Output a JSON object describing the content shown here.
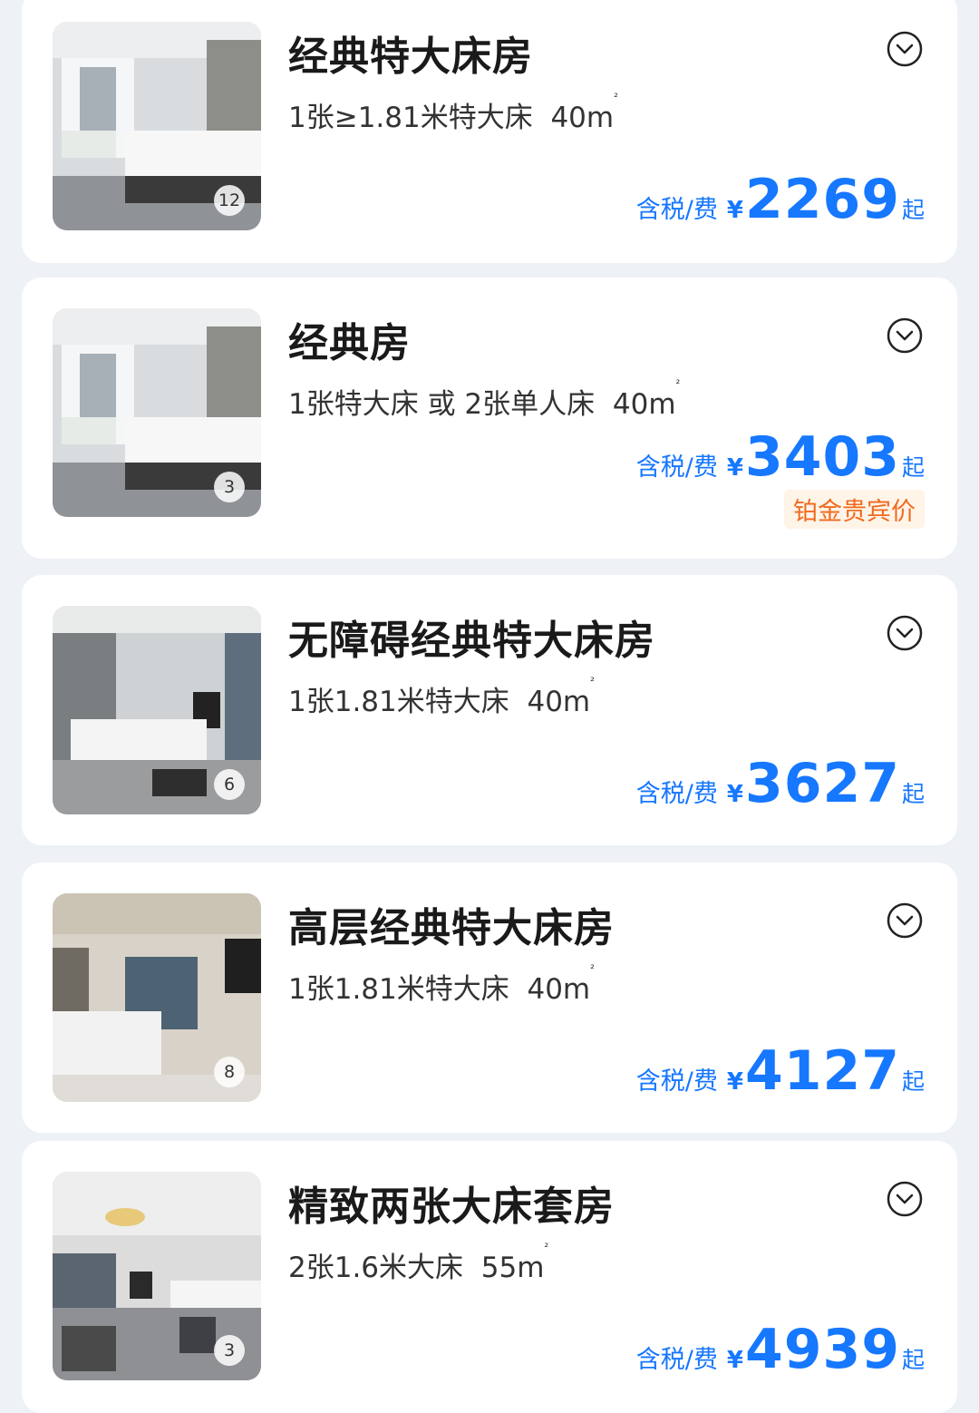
{
  "rooms": [
    {
      "title": "经典特大床房",
      "bed": "1张≥1.81米特大床",
      "area": "40m",
      "area_sup": "²",
      "photo_count": "12",
      "tax_label": "含税/费",
      "currency": "¥",
      "price": "2269",
      "suffix": "起",
      "badge": "",
      "expand_icon": "chevron-down-circle-icon"
    },
    {
      "title": "经典房",
      "bed": "1张特大床 或 2张单人床",
      "area": "40m",
      "area_sup": "²",
      "photo_count": "3",
      "tax_label": "含税/费",
      "currency": "¥",
      "price": "3403",
      "suffix": "起",
      "badge": "铂金贵宾价",
      "expand_icon": "chevron-down-circle-icon"
    },
    {
      "title": "无障碍经典特大床房",
      "bed": "1张1.81米特大床",
      "area": "40m",
      "area_sup": "²",
      "photo_count": "6",
      "tax_label": "含税/费",
      "currency": "¥",
      "price": "3627",
      "suffix": "起",
      "badge": "",
      "expand_icon": "chevron-down-circle-icon"
    },
    {
      "title": "高层经典特大床房",
      "bed": "1张1.81米特大床",
      "area": "40m",
      "area_sup": "²",
      "photo_count": "8",
      "tax_label": "含税/费",
      "currency": "¥",
      "price": "4127",
      "suffix": "起",
      "badge": "",
      "expand_icon": "chevron-down-circle-icon"
    },
    {
      "title": "精致两张大床套房",
      "bed": "2张1.6米大床",
      "area": "55m",
      "area_sup": "²",
      "photo_count": "3",
      "tax_label": "含税/费",
      "currency": "¥",
      "price": "4939",
      "suffix": "起",
      "badge": "",
      "expand_icon": "chevron-down-circle-icon"
    }
  ],
  "colors": {
    "accent": "#1677ff",
    "badge_text": "#f06a1e",
    "badge_bg": "#fff4e8",
    "page_bg": "#eef1f6"
  }
}
